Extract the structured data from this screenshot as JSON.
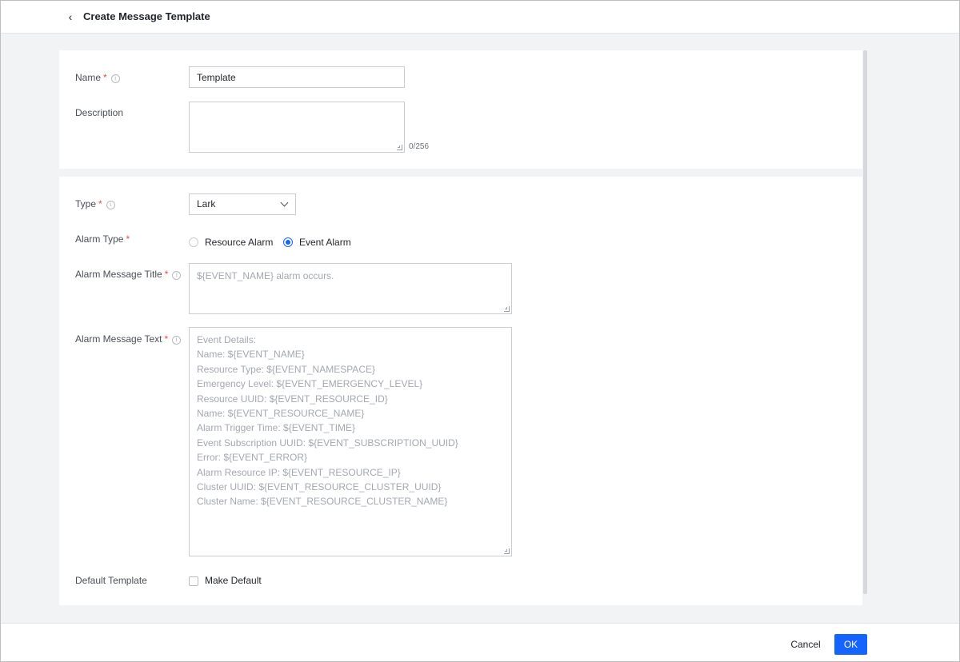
{
  "header": {
    "back_icon": "chevron-left-icon",
    "title": "Create Message Template"
  },
  "basic": {
    "name_label": "Name",
    "required_mark": "*",
    "info_glyph": "i",
    "name_value": "Template",
    "description_label": "Description",
    "description_value": "",
    "description_counter": "0/256"
  },
  "config": {
    "type_label": "Type",
    "type_value": "Lark",
    "alarm_type_label": "Alarm Type",
    "alarm_type_options": [
      {
        "label": "Resource Alarm",
        "selected": false
      },
      {
        "label": "Event Alarm",
        "selected": true
      }
    ],
    "message_title_label": "Alarm Message Title",
    "message_title_placeholder": "${EVENT_NAME} alarm occurs.",
    "message_text_label": "Alarm Message Text",
    "message_text_placeholder": "Event Details:\nName: ${EVENT_NAME}\nResource Type: ${EVENT_NAMESPACE}\nEmergency Level: ${EVENT_EMERGENCY_LEVEL}\nResource UUID: ${EVENT_RESOURCE_ID}\nName: ${EVENT_RESOURCE_NAME}\nAlarm Trigger Time: ${EVENT_TIME}\nEvent Subscription UUID: ${EVENT_SUBSCRIPTION_UUID}\nError: ${EVENT_ERROR}\nAlarm Resource IP: ${EVENT_RESOURCE_IP}\nCluster UUID: ${EVENT_RESOURCE_CLUSTER_UUID}\nCluster Name: ${EVENT_RESOURCE_CLUSTER_NAME}",
    "default_template_label": "Default Template",
    "make_default_label": "Make Default",
    "make_default_checked": false
  },
  "footer": {
    "cancel_label": "Cancel",
    "ok_label": "OK"
  },
  "colors": {
    "accent": "#1664ff",
    "required": "#e5484d"
  }
}
